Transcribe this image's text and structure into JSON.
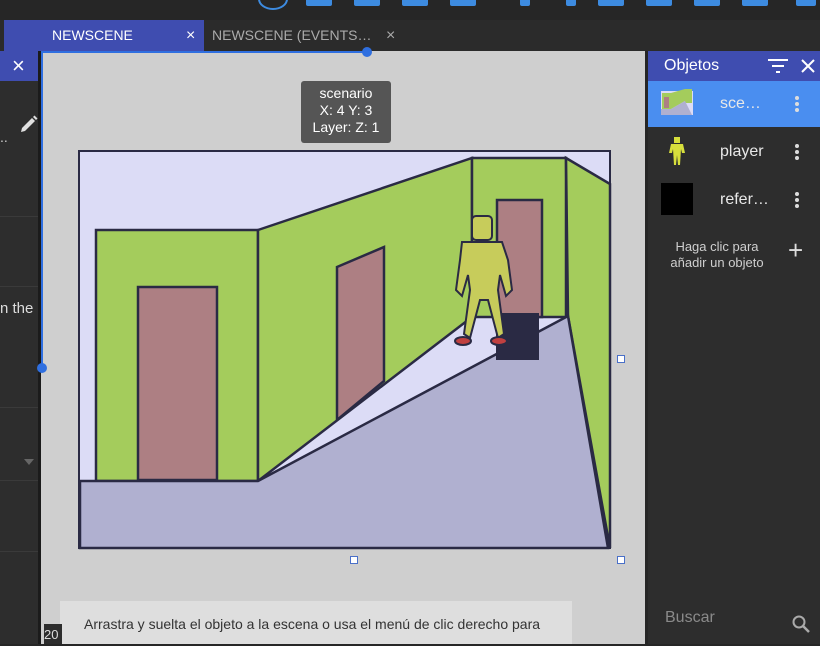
{
  "tabs": [
    {
      "label": "NEWSCENE",
      "close": "×"
    },
    {
      "label": "NEWSCENE (EVENTS…",
      "close": "×"
    }
  ],
  "left_panel": {
    "close": "×",
    "partial_text_1": "..",
    "partial_text_2": "n the"
  },
  "scene": {
    "tooltip": {
      "line1": "scenario",
      "line2": "X: 4  Y: 3",
      "line3": "Layer:   Z: 1"
    },
    "hint": "Arrastra y suelta el objeto a la escena o usa el menú de clic derecho para",
    "corner_number": "20"
  },
  "objects_panel": {
    "title": "Objetos",
    "items": [
      {
        "name": "sce…",
        "selected": true,
        "icon": "scenario-thumbnail"
      },
      {
        "name": "player",
        "selected": false,
        "icon": "player-thumbnail"
      },
      {
        "name": "refer…",
        "selected": false,
        "icon": "black-square-thumbnail"
      }
    ],
    "add_hint": "Haga clic para añadir un objeto",
    "add": "+",
    "search_placeholder": "Buscar"
  },
  "colors": {
    "accent": "#3f4db0",
    "selected_row": "#4a8ef0",
    "selection_blue": "#2f6fe0",
    "wall_green": "#a4cc5c",
    "floor": "#b0b0d0",
    "door": "#ad7f83",
    "sky": "#dcdcf6"
  }
}
